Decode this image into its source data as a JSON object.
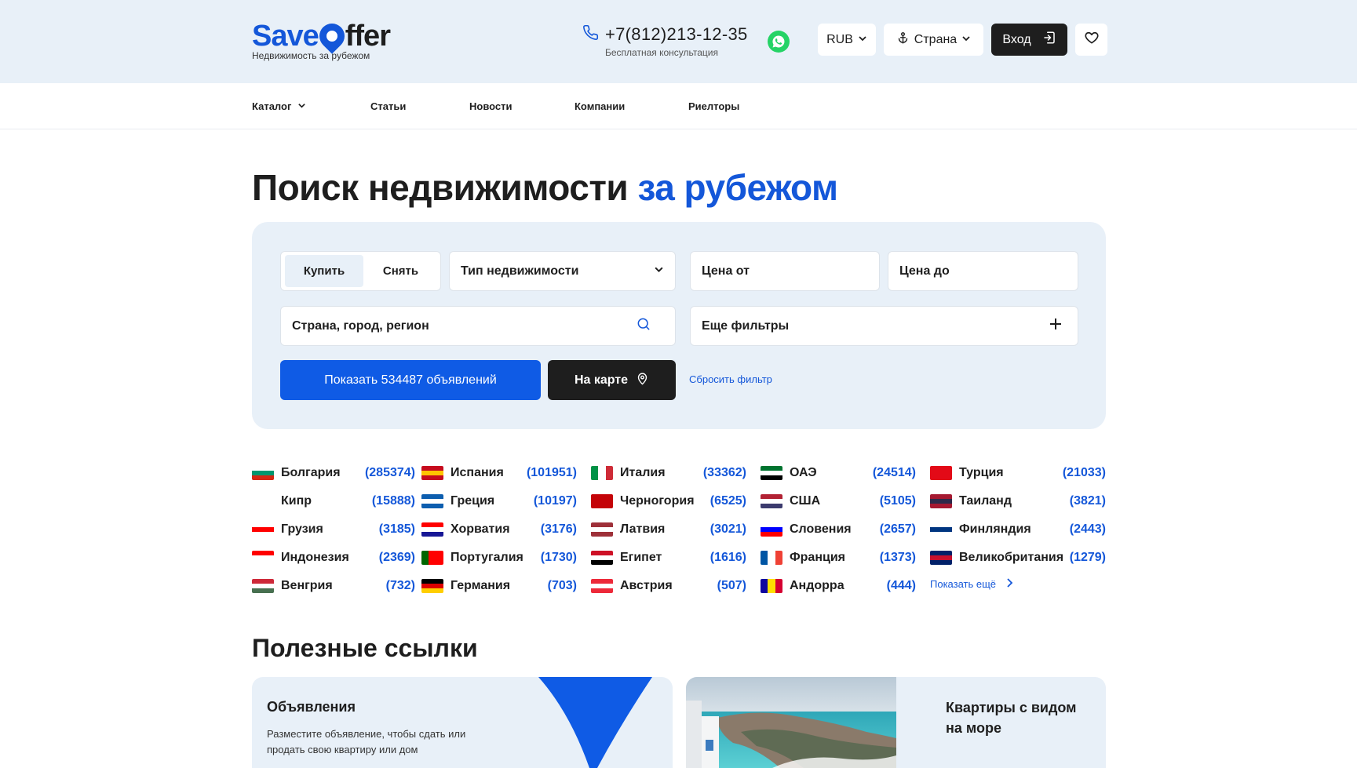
{
  "header": {
    "logo_save": "Save",
    "logo_ffer": "ffer",
    "logo_tagline": "Недвижимость за рубежом",
    "phone": "+7(812)213-12-35",
    "phone_note": "Бесплатная консультация",
    "currency": "RUB",
    "country_label": "Страна",
    "login_label": "Вход"
  },
  "nav": {
    "items": [
      {
        "label": "Каталог"
      },
      {
        "label": "Статьи"
      },
      {
        "label": "Новости"
      },
      {
        "label": "Компании"
      },
      {
        "label": "Риелторы"
      }
    ]
  },
  "hero": {
    "title_main": "Поиск недвижимости",
    "title_accent": "за рубежом"
  },
  "search": {
    "buy_label": "Купить",
    "rent_label": "Снять",
    "type_label": "Тип недвижимости",
    "price_from": "Цена от",
    "price_to": "Цена до",
    "location_label": "Страна, город, регион",
    "more_filters": "Еще фильтры",
    "show_button": "Показать 534487 объявлений",
    "map_button": "На карте",
    "reset_label": "Сбросить фильтр"
  },
  "countries": [
    {
      "name": "Болгария",
      "count": "(285374)",
      "flag": [
        "#ffffff",
        "#00966e",
        "#d62612"
      ]
    },
    {
      "name": "Испания",
      "count": "(101951)",
      "flag": [
        "#c60b1e",
        "#ffc400",
        "#c60b1e"
      ]
    },
    {
      "name": "Италия",
      "count": "(33362)",
      "flag": [
        "#009246",
        "#ffffff",
        "#ce2b37"
      ],
      "vertical": true
    },
    {
      "name": "ОАЭ",
      "count": "(24514)",
      "flag": [
        "#00732f",
        "#ffffff",
        "#000000"
      ]
    },
    {
      "name": "Турция",
      "count": "(21033)",
      "flag": [
        "#e30a17",
        "#e30a17",
        "#e30a17"
      ]
    },
    {
      "name": "Кипр",
      "count": "(15888)",
      "flag": [
        "#ffffff",
        "#ffffff",
        "#ffffff"
      ]
    },
    {
      "name": "Греция",
      "count": "(10197)",
      "flag": [
        "#0d5eaf",
        "#ffffff",
        "#0d5eaf"
      ]
    },
    {
      "name": "Черногория",
      "count": "(6525)",
      "flag": [
        "#c40308",
        "#c40308",
        "#c40308"
      ]
    },
    {
      "name": "США",
      "count": "(5105)",
      "flag": [
        "#b22234",
        "#ffffff",
        "#3c3b6e"
      ]
    },
    {
      "name": "Таиланд",
      "count": "(3821)",
      "flag": [
        "#a51931",
        "#2d2a4a",
        "#a51931"
      ]
    },
    {
      "name": "Грузия",
      "count": "(3185)",
      "flag": [
        "#ffffff",
        "#ff0000",
        "#ffffff"
      ]
    },
    {
      "name": "Хорватия",
      "count": "(3176)",
      "flag": [
        "#ff0000",
        "#ffffff",
        "#171796"
      ]
    },
    {
      "name": "Латвия",
      "count": "(3021)",
      "flag": [
        "#9e3039",
        "#ffffff",
        "#9e3039"
      ]
    },
    {
      "name": "Словения",
      "count": "(2657)",
      "flag": [
        "#ffffff",
        "#0000ff",
        "#ff0000"
      ]
    },
    {
      "name": "Финляндия",
      "count": "(2443)",
      "flag": [
        "#ffffff",
        "#003580",
        "#ffffff"
      ]
    },
    {
      "name": "Индонезия",
      "count": "(2369)",
      "flag": [
        "#ff0000",
        "#ffffff",
        "#ffffff"
      ]
    },
    {
      "name": "Португалия",
      "count": "(1730)",
      "flag": [
        "#006600",
        "#ff0000",
        "#ff0000"
      ],
      "vertical": true
    },
    {
      "name": "Египет",
      "count": "(1616)",
      "flag": [
        "#ce1126",
        "#ffffff",
        "#000000"
      ]
    },
    {
      "name": "Франция",
      "count": "(1373)",
      "flag": [
        "#0055a4",
        "#ffffff",
        "#ef4135"
      ],
      "vertical": true
    },
    {
      "name": "Великобритания",
      "count": "(1279)",
      "flag": [
        "#012169",
        "#c8102e",
        "#012169"
      ]
    },
    {
      "name": "Венгрия",
      "count": "(732)",
      "flag": [
        "#ce2939",
        "#ffffff",
        "#477050"
      ]
    },
    {
      "name": "Германия",
      "count": "(703)",
      "flag": [
        "#000000",
        "#dd0000",
        "#ffce00"
      ]
    },
    {
      "name": "Австрия",
      "count": "(507)",
      "flag": [
        "#ed2939",
        "#ffffff",
        "#ed2939"
      ]
    },
    {
      "name": "Андорра",
      "count": "(444)",
      "flag": [
        "#10069f",
        "#fedf00",
        "#d50032"
      ],
      "vertical": true
    }
  ],
  "show_more": "Показать ещё",
  "useful": {
    "title": "Полезные ссылки",
    "card1_title": "Объявления",
    "card1_text": "Разместите объявление, чтобы сдать или продать свою квартиру или дом",
    "card2_title": "Квартиры с видом на море"
  },
  "colors": {
    "accent": "#1457d9",
    "header_bg": "#e8f0f8",
    "dark": "#1e1e1e"
  }
}
